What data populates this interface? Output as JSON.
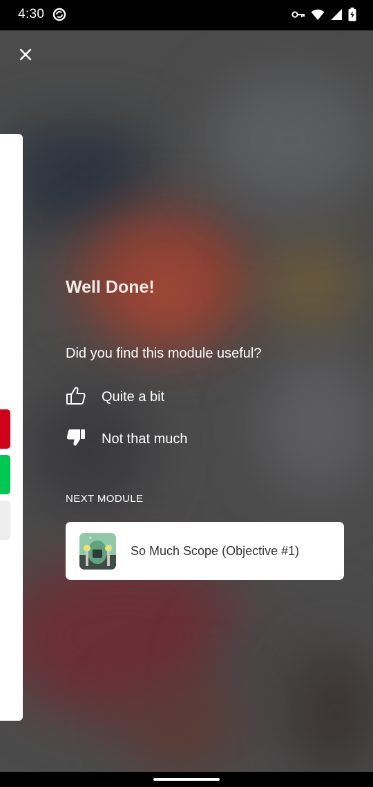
{
  "status_bar": {
    "time": "4:30",
    "icons": [
      "sync-icon",
      "vpn-key-icon",
      "wifi-icon",
      "signal-icon",
      "battery-charging-icon"
    ]
  },
  "overlay": {
    "close_icon": "close-icon",
    "title": "Well Done!",
    "question": "Did you find this module useful?",
    "options": [
      {
        "icon": "thumbs-up-icon",
        "label": "Quite a bit"
      },
      {
        "icon": "thumbs-down-icon",
        "label": "Not that much"
      }
    ],
    "next_module_label": "NEXT MODULE",
    "next_module": {
      "title": "So Much Scope (Objective #1)",
      "thumbnail_icon": "module-thumbnail"
    }
  },
  "colors": {
    "background": "#4b4b4b",
    "card": "#ffffff",
    "accent_red": "#d0021b",
    "accent_green": "#00c853",
    "title_text": "#f3ece8"
  }
}
